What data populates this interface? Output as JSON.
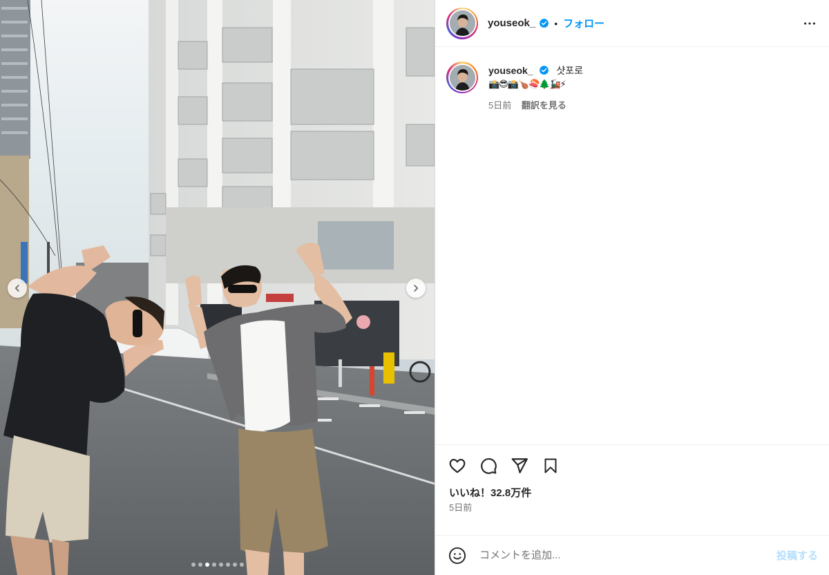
{
  "post": {
    "username": "youseok_",
    "follow_label": "フォロー",
    "separator": "•",
    "caption_text": "샷포로",
    "caption_emojis": "📸😎📸🍗🍣🌲🚂⚡",
    "caption_time": "5日前",
    "translate_label": "翻訳を見る",
    "likes_text": "いいね！32.8万件",
    "post_date": "5日前"
  },
  "comment": {
    "placeholder": "コメントを追加...",
    "post_label": "投稿する"
  },
  "carousel": {
    "total": 8,
    "active_index": 2
  },
  "colors": {
    "link": "#0095f6",
    "verified": "#0095f6",
    "post_disabled": "#b2dffc",
    "muted_text": "#737373"
  },
  "icons": [
    "more-options-icon",
    "verified-icon",
    "heart-icon",
    "comment-icon",
    "share-icon",
    "bookmark-icon",
    "emoji-icon",
    "chevron-left-icon",
    "chevron-right-icon"
  ]
}
